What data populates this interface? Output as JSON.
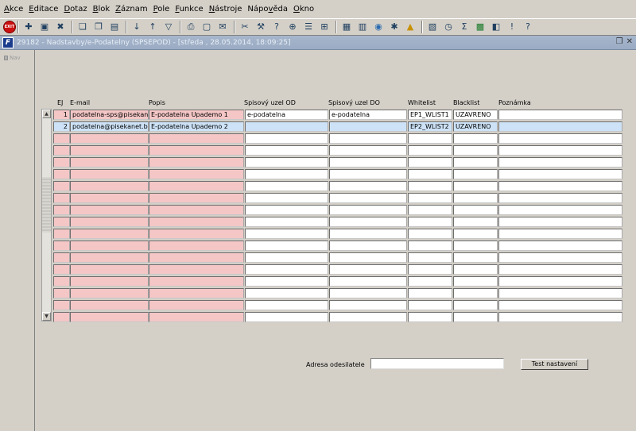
{
  "menu": [
    {
      "pre": "",
      "acc": "A",
      "post": "kce"
    },
    {
      "pre": "",
      "acc": "E",
      "post": "ditace"
    },
    {
      "pre": "",
      "acc": "D",
      "post": "otaz"
    },
    {
      "pre": "",
      "acc": "B",
      "post": "lok"
    },
    {
      "pre": "",
      "acc": "Z",
      "post": "áznam"
    },
    {
      "pre": "",
      "acc": "P",
      "post": "ole"
    },
    {
      "pre": "",
      "acc": "F",
      "post": "unkce"
    },
    {
      "pre": "",
      "acc": "N",
      "post": "ástroje"
    },
    {
      "pre": "Nápo",
      "acc": "v",
      "post": "ěda"
    },
    {
      "pre": "",
      "acc": "O",
      "post": "kno"
    }
  ],
  "toolbar": {
    "exit_label": "EXIT",
    "icons": [
      "add-record-icon",
      "save-icon",
      "delete-icon",
      "sep",
      "copy-icon",
      "paste-icon",
      "form-icon",
      "sep",
      "sort-asc-icon",
      "sort-desc-icon",
      "filter-icon",
      "sep",
      "print-icon",
      "preview-icon",
      "mail-icon",
      "sep",
      "cut-icon",
      "tools-icon",
      "query-icon",
      "zoom-icon",
      "list-icon",
      "grid-icon",
      "sep",
      "calc-icon",
      "report-icon",
      "globe-icon",
      "settings-icon",
      "warning-icon",
      "sep",
      "export-icon",
      "clock-icon",
      "sum-icon",
      "excel-icon",
      "window-icon",
      "help-icon",
      "whatis-icon"
    ]
  },
  "window": {
    "icon_letter": "F",
    "title": "29182 - Nadstavby/e-Podatelny (SPSEPOD) - [středa , 28.05.2014, 18:09:25]",
    "restore_glyph": "❐",
    "close_glyph": "✕"
  },
  "nav": {
    "label": "Nav"
  },
  "grid": {
    "headers": {
      "ej": "EJ",
      "email": "E-mail",
      "popis": "Popis",
      "od": "Spisový uzel OD",
      "do": "Spisový uzel DO",
      "whitelist": "Whitelist",
      "blacklist": "Blacklist",
      "poznamka": "Poznámka"
    },
    "rows": [
      {
        "ej": "1",
        "email": "podatelna-sps@pisekanet.bb",
        "popis": "E-podatelna Upademo 1",
        "od": "e-podatelna",
        "do": "e-podatelna",
        "whitelist": "EP1_WLIST1",
        "blacklist": "UZAVRENO",
        "poznamka": ""
      },
      {
        "ej": "2",
        "email": "podatelna@pisekanet.bbb",
        "popis": "E-podatelna Upademo 2",
        "od": "",
        "do": "",
        "whitelist": "EP2_WLIST2",
        "blacklist": "UZAVRENO",
        "poznamka": ""
      },
      {
        "ej": "",
        "email": "",
        "popis": "",
        "od": "",
        "do": "",
        "whitelist": "",
        "blacklist": "",
        "poznamka": ""
      },
      {
        "ej": "",
        "email": "",
        "popis": "",
        "od": "",
        "do": "",
        "whitelist": "",
        "blacklist": "",
        "poznamka": ""
      },
      {
        "ej": "",
        "email": "",
        "popis": "",
        "od": "",
        "do": "",
        "whitelist": "",
        "blacklist": "",
        "poznamka": ""
      },
      {
        "ej": "",
        "email": "",
        "popis": "",
        "od": "",
        "do": "",
        "whitelist": "",
        "blacklist": "",
        "poznamka": ""
      },
      {
        "ej": "",
        "email": "",
        "popis": "",
        "od": "",
        "do": "",
        "whitelist": "",
        "blacklist": "",
        "poznamka": ""
      },
      {
        "ej": "",
        "email": "",
        "popis": "",
        "od": "",
        "do": "",
        "whitelist": "",
        "blacklist": "",
        "poznamka": ""
      },
      {
        "ej": "",
        "email": "",
        "popis": "",
        "od": "",
        "do": "",
        "whitelist": "",
        "blacklist": "",
        "poznamka": ""
      },
      {
        "ej": "",
        "email": "",
        "popis": "",
        "od": "",
        "do": "",
        "whitelist": "",
        "blacklist": "",
        "poznamka": ""
      },
      {
        "ej": "",
        "email": "",
        "popis": "",
        "od": "",
        "do": "",
        "whitelist": "",
        "blacklist": "",
        "poznamka": ""
      },
      {
        "ej": "",
        "email": "",
        "popis": "",
        "od": "",
        "do": "",
        "whitelist": "",
        "blacklist": "",
        "poznamka": ""
      },
      {
        "ej": "",
        "email": "",
        "popis": "",
        "od": "",
        "do": "",
        "whitelist": "",
        "blacklist": "",
        "poznamka": ""
      },
      {
        "ej": "",
        "email": "",
        "popis": "",
        "od": "",
        "do": "",
        "whitelist": "",
        "blacklist": "",
        "poznamka": ""
      },
      {
        "ej": "",
        "email": "",
        "popis": "",
        "od": "",
        "do": "",
        "whitelist": "",
        "blacklist": "",
        "poznamka": ""
      },
      {
        "ej": "",
        "email": "",
        "popis": "",
        "od": "",
        "do": "",
        "whitelist": "",
        "blacklist": "",
        "poznamka": ""
      },
      {
        "ej": "",
        "email": "",
        "popis": "",
        "od": "",
        "do": "",
        "whitelist": "",
        "blacklist": "",
        "poznamka": ""
      },
      {
        "ej": "",
        "email": "",
        "popis": "",
        "od": "",
        "do": "",
        "whitelist": "",
        "blacklist": "",
        "poznamka": ""
      }
    ],
    "selected_index": 1
  },
  "form": {
    "sender_label": "Adresa odesilatele",
    "sender_value": "",
    "test_button": "Test nastavení"
  }
}
